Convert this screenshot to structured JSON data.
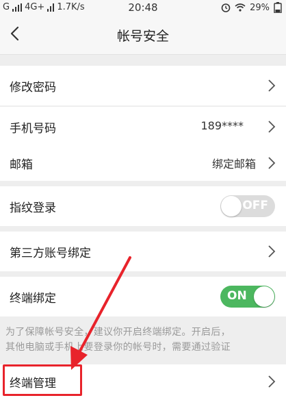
{
  "status_bar": {
    "carrier": "G",
    "network": "4G+",
    "speed": "1.7K/s",
    "time": "20:48",
    "battery": "29%"
  },
  "nav": {
    "title": "帐号安全"
  },
  "rows": {
    "change_password": {
      "label": "修改密码"
    },
    "phone": {
      "label": "手机号码",
      "value": "189****"
    },
    "email": {
      "label": "邮箱",
      "value": "绑定邮箱"
    },
    "fingerprint": {
      "label": "指纹登录",
      "toggle": "OFF"
    },
    "third_party": {
      "label": "第三方账号绑定"
    },
    "device_binding": {
      "label": "终端绑定",
      "toggle": "ON"
    },
    "device_management": {
      "label": "终端管理"
    }
  },
  "hint": {
    "line1": "为了保障帐号安全，建议你开启终端绑定。开启后，",
    "line2": "其他电脑或手机上要登录你的帐号时，需要通过验证"
  },
  "colors": {
    "toggle_on": "#4cb75f",
    "toggle_off": "#dcdcdc",
    "annotation": "#e8232b"
  }
}
